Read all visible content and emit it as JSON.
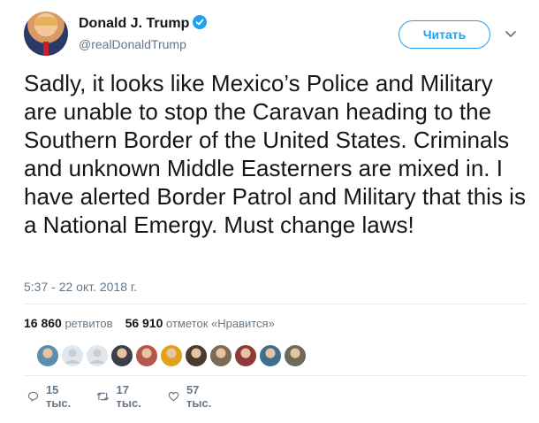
{
  "tweet": {
    "author_name": "Donald J. Trump",
    "author_handle": "@realDonaldTrump",
    "follow_label": "Читать",
    "text": "Sadly, it looks like Mexico’s Police and Military are unable to stop the Caravan heading to the Southern Border of the United States. Criminals and unknown Middle Easterners are mixed in. I have alerted Border Patrol and Military that this is a National Emergy. Must change laws!",
    "timestamp": "5:37 - 22 окт. 2018 г."
  },
  "stats": {
    "retweets_count": "16 860",
    "retweets_label": "ретвитов",
    "likes_count": "56 910",
    "likes_label": "отметок «Нравится»"
  },
  "likers": [
    {
      "icon": "user-avatar-icon",
      "color": "#5a8fb0"
    },
    {
      "icon": "default-avatar-icon",
      "color": "#c7ced4"
    },
    {
      "icon": "default-avatar-icon",
      "color": "#c7ced4"
    },
    {
      "icon": "user-avatar-icon",
      "color": "#3b3f4a"
    },
    {
      "icon": "user-avatar-icon",
      "color": "#b5574a"
    },
    {
      "icon": "user-avatar-icon",
      "color": "#e0a21b"
    },
    {
      "icon": "user-avatar-icon",
      "color": "#4a3a32"
    },
    {
      "icon": "user-avatar-icon",
      "color": "#7a6b55"
    },
    {
      "icon": "user-avatar-icon",
      "color": "#8e3a3a"
    },
    {
      "icon": "user-avatar-icon",
      "color": "#3f6f8a"
    },
    {
      "icon": "user-avatar-icon",
      "color": "#6b6b5a"
    }
  ],
  "actions": {
    "replies": "15 тыс.",
    "retweets": "17 тыс.",
    "likes": "57 тыс."
  },
  "colors": {
    "accent": "#1da1f2",
    "text": "#14171a",
    "secondary": "#657786",
    "divider": "#e6ecf0"
  }
}
